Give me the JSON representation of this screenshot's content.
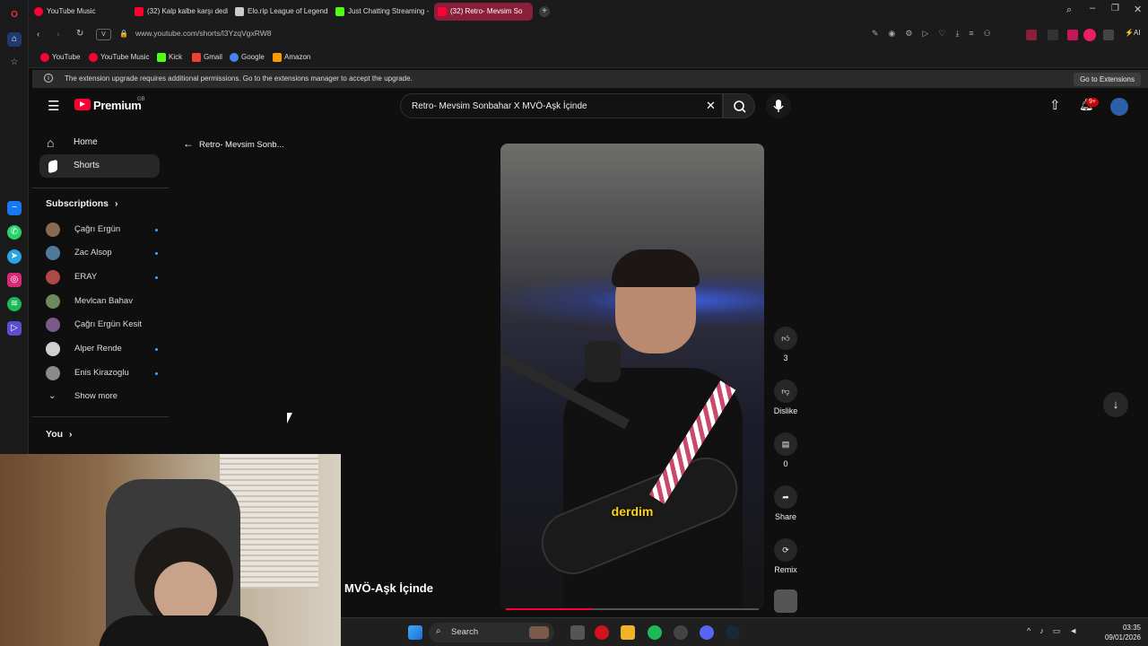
{
  "browser": {
    "tabs": [
      {
        "label": "YouTube Music",
        "color": "#ff0033"
      },
      {
        "label": "(32) Kalp kalbe karşı dedik",
        "color": "#ff0033"
      },
      {
        "label": "Elo.rip League of Legends",
        "color": "#cccccc"
      },
      {
        "label": "Just Chatting Streaming -",
        "color": "#53fc18"
      },
      {
        "label": "(32) Retro- Mevsim So",
        "color": "#ff0033",
        "active": true
      }
    ],
    "url": "www.youtube.com/shorts/l3YzqVgxRW8",
    "bookmarks": [
      {
        "label": "YouTube",
        "color": "#ff0033"
      },
      {
        "label": "YouTube Music",
        "color": "#ff0033"
      },
      {
        "label": "Kick",
        "color": "#53fc18"
      },
      {
        "label": "Gmail",
        "color": "#ea4335"
      },
      {
        "label": "Google",
        "color": "#4285f4"
      },
      {
        "label": "Amazon",
        "color": "#ff9900"
      }
    ],
    "notice": "The extension upgrade requires additional permissions. Go to the extensions manager to accept the upgrade.",
    "notice_button": "Go to Extensions"
  },
  "youtube": {
    "logo": "Premium",
    "logo_country": "GB",
    "search_value": "Retro- Mevsim Sonbahar X MVÖ-Aşk İçinde",
    "notification_count": "9+",
    "back_title": "Retro- Mevsim Sonb...",
    "nav": {
      "home": "Home",
      "shorts": "Shorts"
    },
    "subscriptions_title": "Subscriptions",
    "subscriptions": [
      {
        "name": "Çağrı Ergün",
        "live": true,
        "color": "#8a6a4f"
      },
      {
        "name": "Zac Alsop",
        "live": true,
        "color": "#4f7a9a"
      },
      {
        "name": "ERAY",
        "live": true,
        "color": "#b04848"
      },
      {
        "name": "Mevlcan Bahav",
        "live": false,
        "color": "#6a8a5a"
      },
      {
        "name": "Çağrı Ergün Kesit",
        "live": false,
        "color": "#7a5a8a"
      },
      {
        "name": "Alper Rende",
        "live": true,
        "color": "#d0d0d0"
      },
      {
        "name": "Enis Kirazoglu",
        "live": true,
        "color": "#8a8a8a"
      }
    ],
    "show_more": "Show more",
    "you": "You",
    "short_caption": "derdim",
    "short_title": "MVÖ-Aşk İçinde",
    "actions": {
      "like_count": "3",
      "dislike": "Dislike",
      "comment_count": "0",
      "share": "Share",
      "remix": "Remix"
    }
  },
  "taskbar": {
    "search": "Search",
    "time": "03:35",
    "date": "09/01/2026"
  }
}
